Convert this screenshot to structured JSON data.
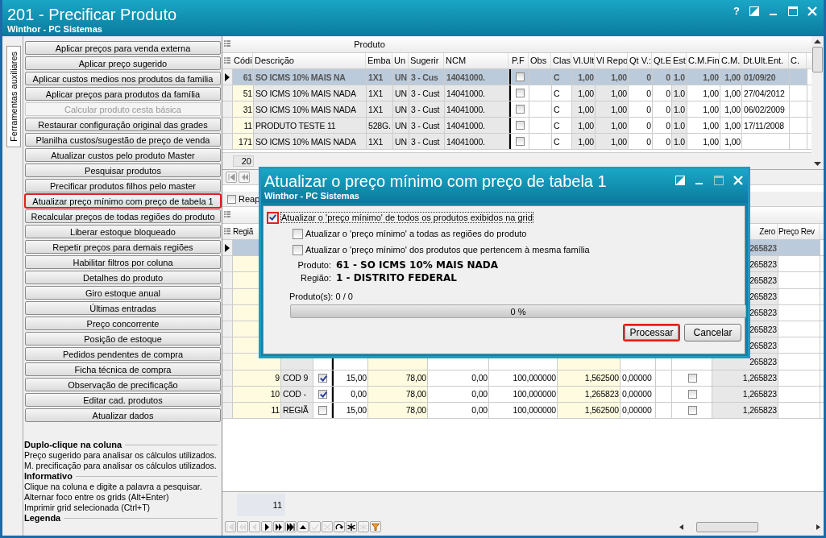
{
  "window": {
    "title": "201 - Precificar Produto",
    "subtitle": "Winthor - PC Sistemas",
    "help": "?"
  },
  "side_tab": {
    "label": "Ferramentas auxiliares",
    "selected": true
  },
  "tools": [
    {
      "label": "Aplicar preços para venda externa",
      "disabled": false,
      "highlighted": false
    },
    {
      "label": "Aplicar preço sugerido",
      "disabled": false,
      "highlighted": false
    },
    {
      "label": "Aplicar custos medios nos produtos da familia",
      "disabled": false,
      "highlighted": false
    },
    {
      "label": "Aplicar preços para produtos da família",
      "disabled": false,
      "highlighted": false
    },
    {
      "label": "Calcular produto cesta básica",
      "disabled": true,
      "highlighted": false
    },
    {
      "label": "Restaurar configuração original das grades",
      "disabled": false,
      "highlighted": false
    },
    {
      "label": "Planilha custos/sugestão de preço de venda",
      "disabled": false,
      "highlighted": false
    },
    {
      "label": "Atualizar custos pelo produto Master",
      "disabled": false,
      "highlighted": false
    },
    {
      "label": "Pesquisar produtos",
      "disabled": false,
      "highlighted": false
    },
    {
      "label": "Precificar produtos filhos pelo master",
      "disabled": false,
      "highlighted": false
    },
    {
      "label": "Atualizar preço mínimo com preço de tabela 1",
      "disabled": false,
      "highlighted": true
    },
    {
      "label": "Recalcular preços de todas regiões do produto",
      "disabled": false,
      "highlighted": false
    },
    {
      "label": "Liberar estoque bloqueado",
      "disabled": false,
      "highlighted": false
    },
    {
      "label": "Repetir preços para demais regiões",
      "disabled": false,
      "highlighted": false
    },
    {
      "label": "Habilitar filtros por coluna",
      "disabled": false,
      "highlighted": false
    },
    {
      "label": "Detalhes do produto",
      "disabled": false,
      "highlighted": false
    },
    {
      "label": "Giro estoque anual",
      "disabled": false,
      "highlighted": false
    },
    {
      "label": "Últimas entradas",
      "disabled": false,
      "highlighted": false
    },
    {
      "label": "Preço concorrente",
      "disabled": false,
      "highlighted": false
    },
    {
      "label": "Posição de estoque",
      "disabled": false,
      "highlighted": false
    },
    {
      "label": "Pedidos pendentes de compra",
      "disabled": false,
      "highlighted": false
    },
    {
      "label": "Ficha técnica de compra",
      "disabled": false,
      "highlighted": false
    },
    {
      "label": "Observação de precificação",
      "disabled": false,
      "highlighted": false
    },
    {
      "label": "Editar cad. produtos",
      "disabled": false,
      "highlighted": false
    },
    {
      "label": "Atualizar dados",
      "disabled": false,
      "highlighted": false
    }
  ],
  "help": [
    {
      "heading": "Duplo-clique na coluna",
      "lines": [
        "Preço sugerido para analisar os cálculos utilizados.",
        "M. precificação para analisar os cálculos utilizados."
      ]
    },
    {
      "heading": "Informativo",
      "lines": [
        "Clique na coluna e digite a palavra a pesquisar.",
        "Alternar foco entre os grids (Alt+Enter)",
        "Imprimir grid selecionada (Ctrl+T)"
      ]
    },
    {
      "heading": "Legenda"
    }
  ],
  "product_grid": {
    "group_header": "Produto",
    "columns": [
      "Códi",
      "Descrição",
      "Emba",
      "Un",
      "Sugerir",
      "NCM",
      "P.F",
      "Obs",
      "Clas",
      "Vl.Ult",
      "Vl Repo",
      "Qt V.:",
      "Qt.E",
      "Est",
      "C.M.Fin",
      "C.M.",
      "Dt.Ult.Ent.",
      "C."
    ],
    "rows": [
      {
        "selected": true,
        "cells": [
          "61",
          "SO ICMS 10% MAIS NA",
          "1X1",
          "UN",
          "3 - Cus",
          "14041000.",
          {
            "checked": false
          },
          null,
          "C",
          "1,00",
          "1,00",
          "0",
          "0",
          "1.0",
          "1,00",
          "1,00",
          "01/09/20",
          null
        ]
      },
      {
        "selected": false,
        "cells": [
          "51",
          "SO ICMS 10% MAIS NADA",
          "1X1",
          "UN",
          "3 - Cust",
          "14041000.",
          {
            "checked": false
          },
          null,
          "C",
          "1,00",
          "1,00",
          "0",
          "0",
          "1.0",
          "1,00",
          "1,00",
          "27/04/2012",
          null
        ]
      },
      {
        "selected": false,
        "cells": [
          "31",
          "SO ICMS 10% MAIS NADA",
          "1X1",
          "UN",
          "3 - Cust",
          "14041000.",
          {
            "checked": false
          },
          null,
          "C",
          "1,00",
          "1,00",
          "0",
          "0",
          "1.0",
          "1,00",
          "1,00",
          "06/02/2009",
          null
        ]
      },
      {
        "selected": false,
        "cells": [
          "11",
          "PRODUTO TESTE 11",
          "528G.",
          "UN",
          "3 - Cust",
          "14041000.",
          {
            "checked": false
          },
          null,
          "C",
          "1,00",
          "1,00",
          "0",
          "0",
          "1.0",
          "1,00",
          "1,00",
          "17/11/2008",
          null
        ]
      },
      {
        "selected": false,
        "cells": [
          "171",
          "SO ICMS 10% MAIS NADA",
          "1X1",
          "UN",
          "3 - Cust",
          "14041000.",
          {
            "checked": false
          },
          null,
          "C",
          "1,00",
          "1,00",
          "0",
          "0",
          "1.0",
          "1,00",
          "1,00",
          null,
          null
        ]
      }
    ],
    "footer": "20"
  },
  "regions_grid": {
    "reapply": {
      "label": "Reap",
      "checked": false
    },
    "columns": [
      "Regiã",
      null,
      null,
      null,
      null,
      null,
      null,
      null,
      null,
      null,
      null,
      "Zero",
      "Preço Rev"
    ],
    "rows": [
      {
        "selected": true,
        "cells": [
          null,
          null,
          null,
          null,
          null,
          null,
          null,
          null,
          null,
          null,
          null,
          "265823",
          null
        ]
      },
      {
        "selected": false,
        "cells": [
          null,
          null,
          null,
          null,
          null,
          null,
          null,
          null,
          null,
          null,
          null,
          "265823",
          null
        ]
      },
      {
        "selected": false,
        "cells": [
          null,
          null,
          null,
          null,
          null,
          null,
          null,
          null,
          null,
          null,
          null,
          "265823",
          null
        ]
      },
      {
        "selected": false,
        "cells": [
          null,
          null,
          null,
          null,
          null,
          null,
          null,
          null,
          null,
          null,
          null,
          "265823",
          null
        ]
      },
      {
        "selected": false,
        "cells": [
          null,
          null,
          null,
          null,
          null,
          null,
          null,
          null,
          null,
          null,
          null,
          "265823",
          null
        ]
      },
      {
        "selected": false,
        "cells": [
          null,
          null,
          null,
          null,
          null,
          null,
          null,
          null,
          null,
          null,
          null,
          "265823",
          null
        ]
      },
      {
        "selected": false,
        "cells": [
          null,
          null,
          null,
          null,
          null,
          null,
          null,
          null,
          null,
          null,
          null,
          "265823",
          null
        ]
      },
      {
        "selected": false,
        "cells": [
          null,
          null,
          null,
          null,
          null,
          null,
          null,
          null,
          null,
          null,
          null,
          "265823",
          null
        ]
      },
      {
        "selected": false,
        "cells": [
          "9",
          "COD 9",
          {
            "checked": true
          },
          "15,00",
          "78,00",
          "0,00",
          "100,000000",
          "1,562500",
          "0,00000",
          null,
          {
            "checked": false
          },
          "1,265823",
          null
        ]
      },
      {
        "selected": false,
        "cells": [
          "10",
          "COD -",
          {
            "checked": true
          },
          "0,00",
          "78,00",
          "0,00",
          "100,000000",
          "1,265823",
          "0,00000",
          null,
          {
            "checked": false
          },
          "1,265823",
          null
        ]
      },
      {
        "selected": false,
        "cells": [
          "11",
          "REGIÃ",
          {
            "checked": false
          },
          "15,00",
          "78,00",
          "0,00",
          "100,000000",
          "1,562500",
          "0,00000",
          null,
          {
            "checked": false
          },
          "1,265823",
          null
        ]
      }
    ],
    "footer": "11",
    "nav_buttons": [
      {
        "kind": "first",
        "disabled": true
      },
      {
        "kind": "prev-page",
        "disabled": true
      },
      {
        "kind": "prev",
        "disabled": true
      },
      {
        "kind": "next",
        "disabled": false
      },
      {
        "kind": "next-page",
        "disabled": false
      },
      {
        "kind": "last",
        "disabled": false
      },
      {
        "kind": "up",
        "disabled": false
      },
      {
        "kind": "check",
        "disabled": true
      },
      {
        "kind": "cancel",
        "disabled": true
      },
      {
        "kind": "refresh",
        "disabled": false
      },
      {
        "kind": "star",
        "disabled": false
      },
      {
        "kind": "star",
        "disabled": true
      },
      {
        "kind": "filter",
        "disabled": false
      }
    ]
  },
  "dialog": {
    "title": "Atualizar o preço mínimo com preço de tabela 1",
    "subtitle": "Winthor - PC Sistemas",
    "options": [
      {
        "label": "Atualizar o 'preço mínimo' de todos os produtos exibidos na grid",
        "checked": true,
        "highlighted": true,
        "children": [
          {
            "label": "Atualizar o 'preço mínimo' a todas as regiões do produto",
            "checked": false,
            "highlighted": false
          },
          {
            "label": "Atualizar o 'preço mínimo' dos produtos que pertencem à mesma família",
            "checked": false,
            "highlighted": false
          }
        ]
      }
    ],
    "product_label": "Produto:",
    "product_value": "61 - SO ICMS 10% MAIS NADA",
    "region_label": "Região:",
    "region_value": "1 - DISTRITO FEDERAL",
    "count": "Produto(s): 0 / 0",
    "progress": {
      "level": 0,
      "text": "0 %"
    },
    "buttons": [
      {
        "label": "Processar",
        "highlighted": true
      },
      {
        "label": "Cancelar",
        "highlighted": false
      }
    ]
  }
}
